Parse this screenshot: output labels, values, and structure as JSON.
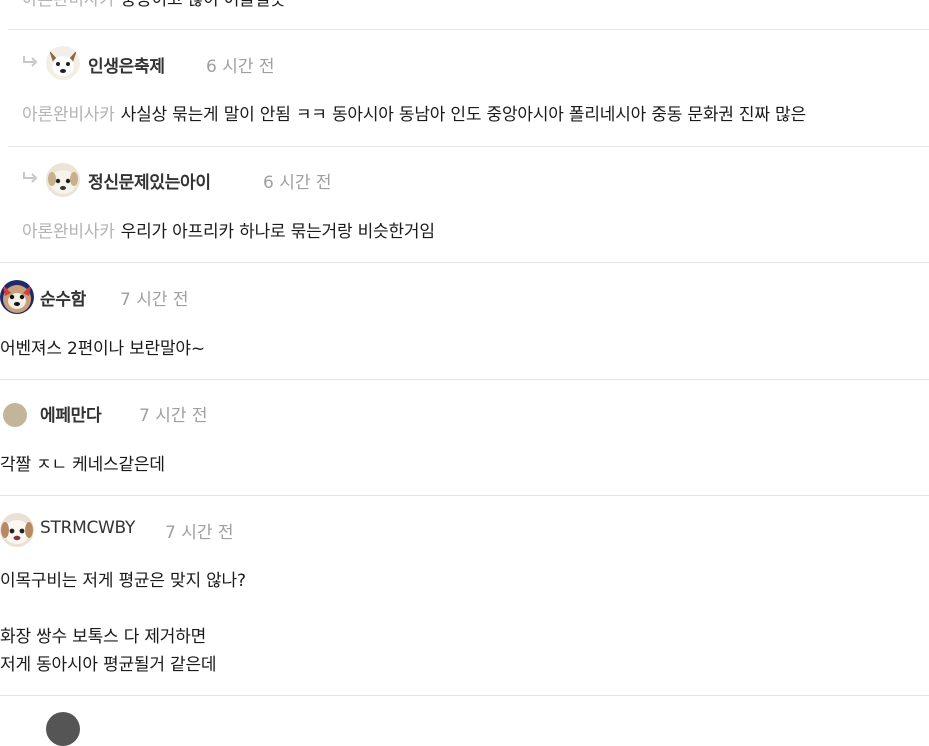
{
  "comments": [
    {
      "type": "reply",
      "mention": "아론완비사카",
      "text": "중동이고 많이 어울릴듯"
    },
    {
      "type": "reply",
      "username": "인생은축제",
      "time": "6 시간 전",
      "mention": "아론완비사카",
      "text": "사실상 묶는게 말이 안됨 ㅋㅋ 동아시아 동남아 인도 중앙아시아 폴리네시아 중동 문화권 진짜 많은"
    },
    {
      "type": "reply",
      "username": "정신문제있는아이",
      "time": "6 시간 전",
      "mention": "아론완비사카",
      "text": "우리가 아프리카 하나로 묶는거랑 비슷한거임"
    },
    {
      "type": "top",
      "username": "순수함",
      "time": "7 시간 전",
      "text": "어벤져스 2편이나 보란말야~"
    },
    {
      "type": "top",
      "username": "에페만다",
      "time": "7 시간 전",
      "text": "각짤 ㅈㄴ 케네스같은데"
    },
    {
      "type": "top",
      "username": "STRMCWBY",
      "time": "7 시간 전",
      "lines": [
        "이목구비는 저게 평균은 맞지 않나?",
        "",
        "화장 쌍수 보톡스 다 제거하면",
        "저게 동아시아 평균될거 같은데"
      ]
    }
  ],
  "colors": {
    "divider": "#e6e6e6",
    "mention": "#b3b3b3",
    "time": "#a0a0a0",
    "reply_arrow": "#c8c8c8",
    "plain_avatar": "#c2b59a"
  },
  "icons": {
    "reply": "reply-arrow-icon"
  }
}
